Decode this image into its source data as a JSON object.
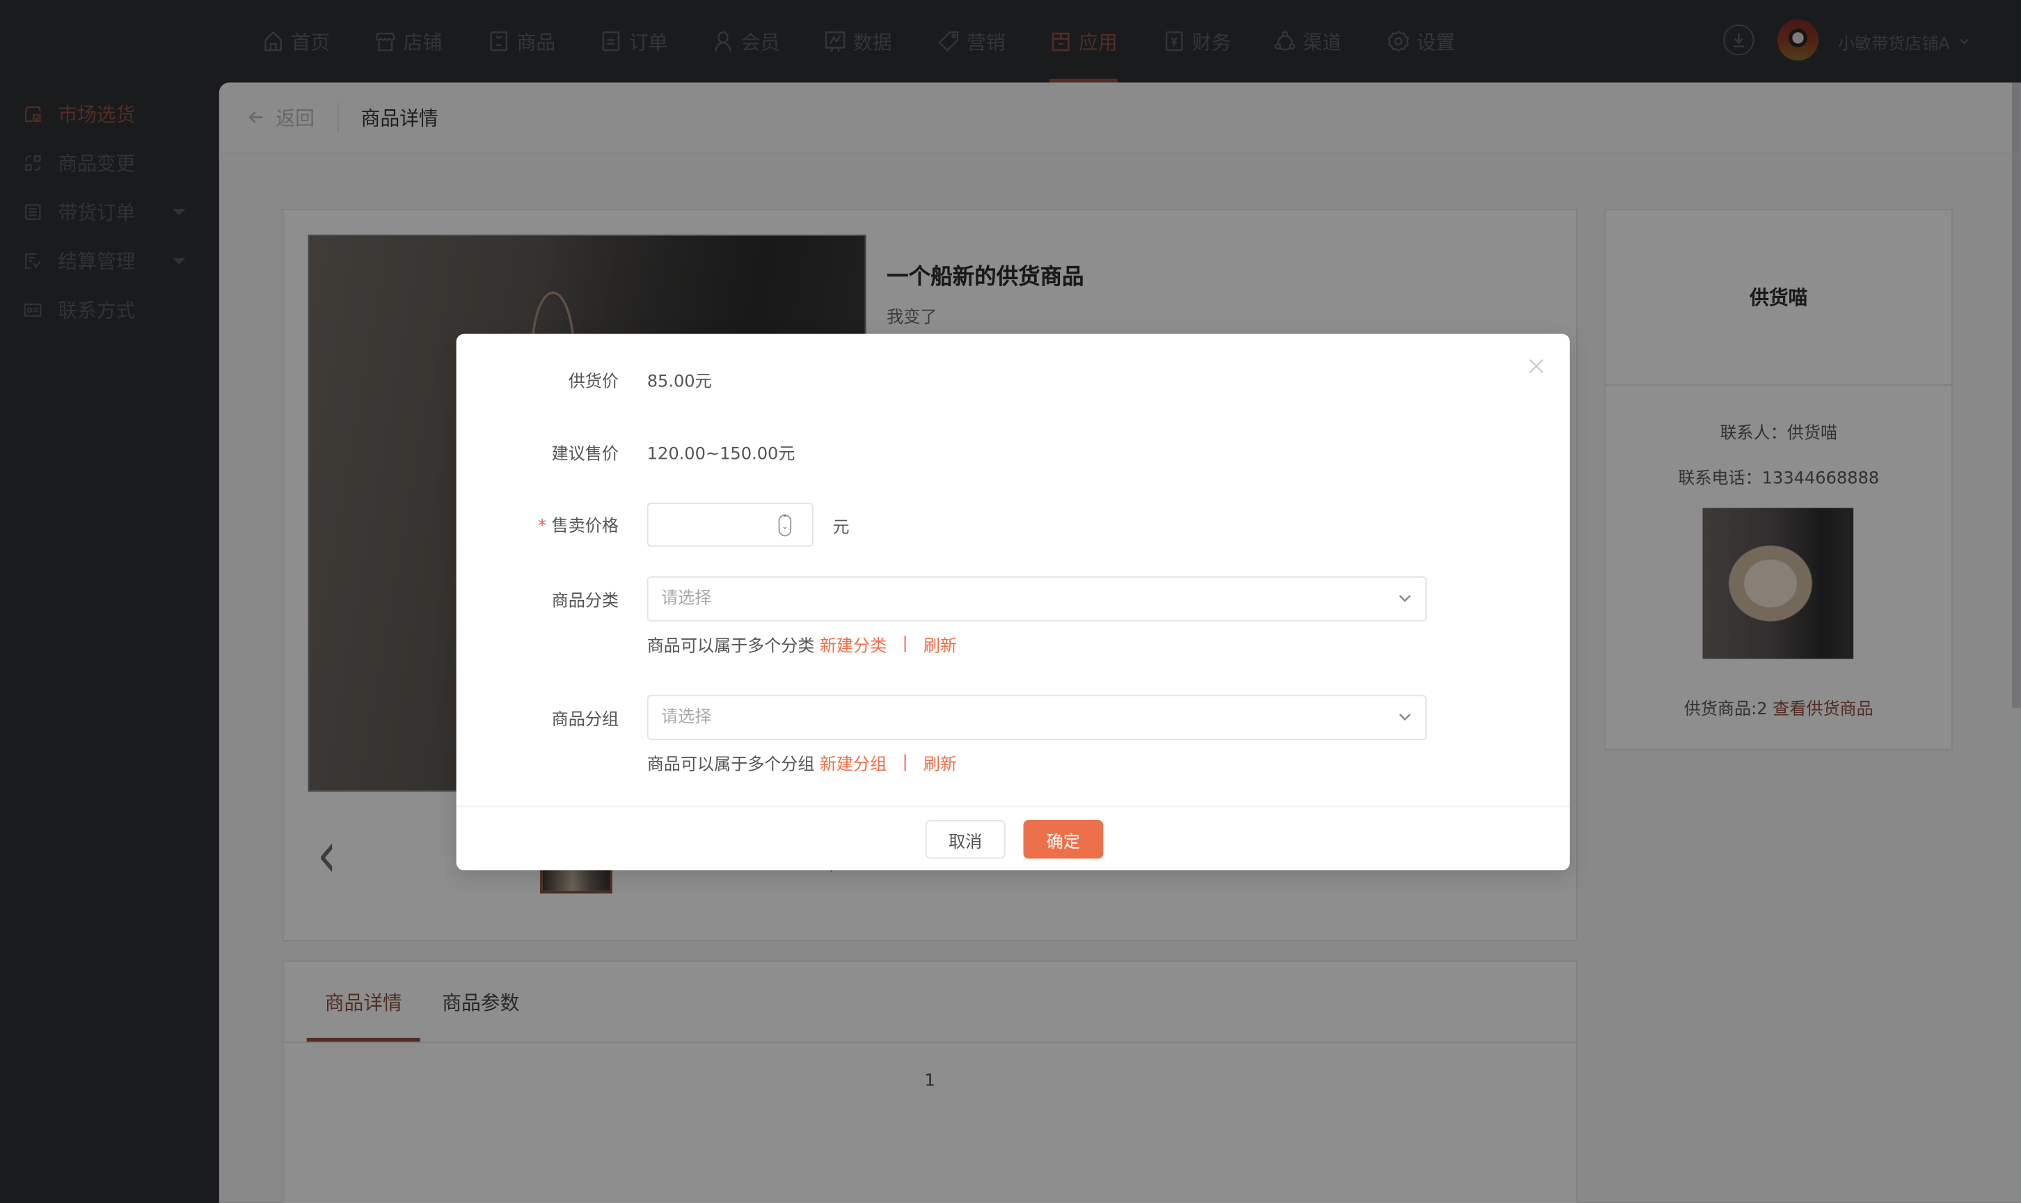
{
  "topnav": {
    "items": [
      {
        "label": "首页",
        "icon": "home-icon"
      },
      {
        "label": "店铺",
        "icon": "store-icon"
      },
      {
        "label": "商品",
        "icon": "bag-icon"
      },
      {
        "label": "订单",
        "icon": "order-icon"
      },
      {
        "label": "会员",
        "icon": "user-icon"
      },
      {
        "label": "数据",
        "icon": "chart-icon"
      },
      {
        "label": "营销",
        "icon": "tag-icon"
      },
      {
        "label": "应用",
        "icon": "box-icon",
        "active": true
      },
      {
        "label": "财务",
        "icon": "yuan-icon"
      },
      {
        "label": "渠道",
        "icon": "share-icon"
      },
      {
        "label": "设置",
        "icon": "gear-icon"
      }
    ],
    "shop_name": "小敏带货店铺A"
  },
  "sidebar": {
    "items": [
      {
        "label": "市场选货",
        "icon": "market-icon",
        "active": true
      },
      {
        "label": "商品变更",
        "icon": "change-icon"
      },
      {
        "label": "带货订单",
        "icon": "list-icon",
        "expandable": true
      },
      {
        "label": "结算管理",
        "icon": "settle-icon",
        "expandable": true
      },
      {
        "label": "联系方式",
        "icon": "contact-card-icon"
      }
    ]
  },
  "page": {
    "back_label": "返回",
    "title": "商品详情"
  },
  "product": {
    "title": "一个船新的供货商品",
    "subtitle": "我变了"
  },
  "supplier": {
    "name": "供货喵",
    "contact_label": "联系人：",
    "contact_value": "供货喵",
    "phone_label": "联系电话：",
    "phone_value": "13344668888",
    "count_label": "供货商品:2",
    "view_link": "查看供货商品"
  },
  "tabs": {
    "items": [
      {
        "label": "商品详情",
        "active": true
      },
      {
        "label": "商品参数"
      }
    ],
    "content": "1"
  },
  "modal": {
    "supply_price_label": "供货价",
    "supply_price_value": "85.00元",
    "suggested_label": "建议售价",
    "suggested_value": "120.00~150.00元",
    "sale_price_label": "售卖价格",
    "sale_price_value": "",
    "sale_price_unit": "元",
    "category_label": "商品分类",
    "category_placeholder": "请选择",
    "category_hint": "商品可以属于多个分类",
    "category_new": "新建分类",
    "group_label": "商品分组",
    "group_placeholder": "请选择",
    "group_hint": "商品可以属于多个分组",
    "group_new": "新建分组",
    "refresh": "刷新",
    "separator": "|",
    "cancel": "取消",
    "confirm": "确定"
  },
  "colors": {
    "accent": "#ec714a",
    "nav_bg": "#2e2f33"
  }
}
